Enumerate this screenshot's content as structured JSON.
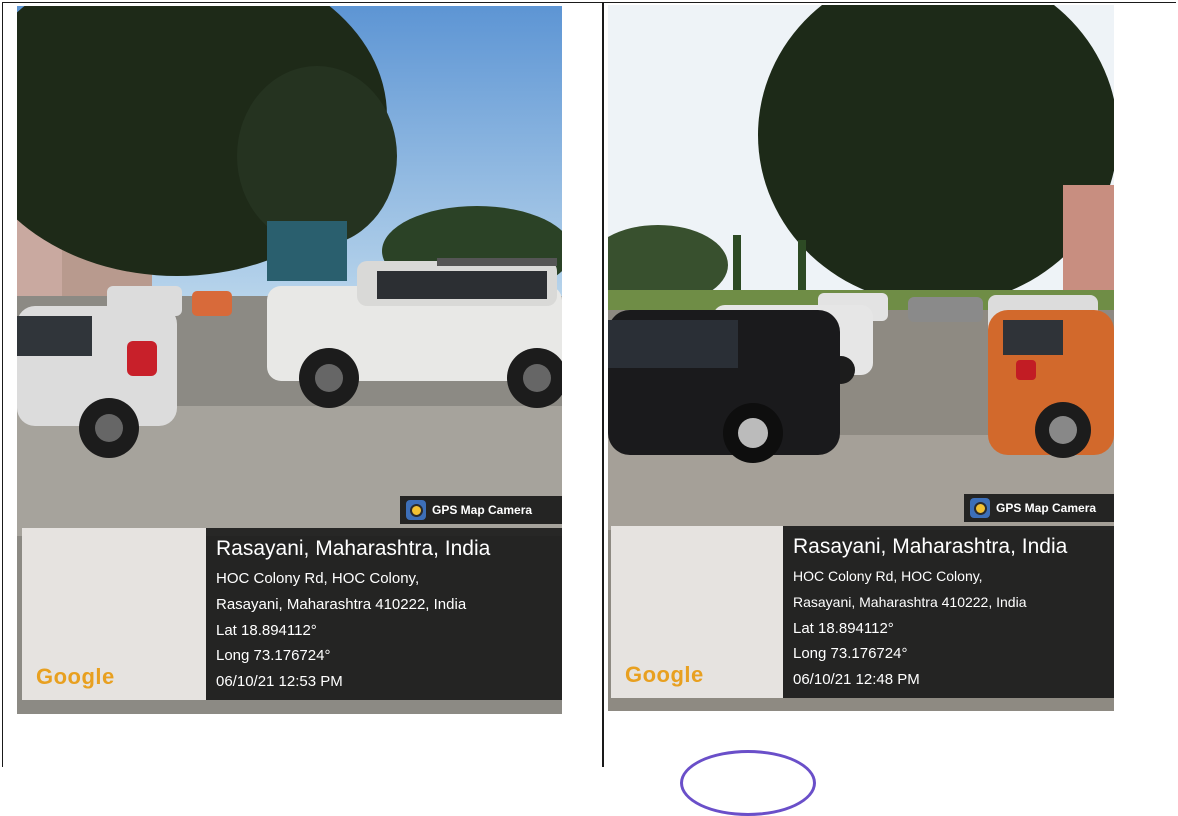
{
  "photos": [
    {
      "badge": "GPS Map Camera",
      "map_label": "Google",
      "location_title": "Rasayani, Maharashtra, India",
      "address_line1": "HOC Colony Rd, HOC Colony,",
      "address_line2": "Rasayani, Maharashtra 410222, India",
      "lat": "Lat 18.894112°",
      "long": "Long 73.176724°",
      "datetime": "06/10/21 12:53 PM"
    },
    {
      "badge": "GPS Map Camera",
      "map_label": "Google",
      "location_title": "Rasayani, Maharashtra, India",
      "address_line1": "HOC Colony Rd, HOC Colony,",
      "address_line2": "Rasayani, Maharashtra 410222, India",
      "lat": "Lat 18.894112°",
      "long": "Long 73.176724°",
      "datetime": "06/10/21 12:48 PM"
    }
  ],
  "colors": {
    "badge_bg": "#191919",
    "info_bg": "#161616",
    "map_bg": "#e6e3e0",
    "stamp": "#6a4fc9"
  }
}
